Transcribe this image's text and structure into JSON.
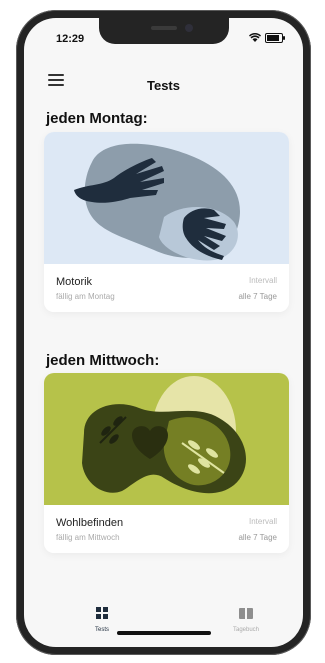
{
  "status_bar": {
    "time": "12:29"
  },
  "header": {
    "title": "Tests"
  },
  "sections": [
    {
      "title": "jeden Montag:",
      "card": {
        "name": "Motorik",
        "due": "fällig am Montag",
        "interval_label": "Intervall",
        "interval_value": "alle 7 Tage"
      }
    },
    {
      "title": "jeden Mittwoch:",
      "card": {
        "name": "Wohlbefinden",
        "due": "fällig am Mittwoch",
        "interval_label": "Intervall",
        "interval_value": "alle 7 Tage"
      }
    }
  ],
  "tabs": [
    {
      "label": "Tests",
      "icon": "grid-icon",
      "active": true
    },
    {
      "label": "Tagebuch",
      "icon": "book-icon",
      "active": false
    }
  ],
  "colors": {
    "accent": "#1f2d3d",
    "motorik_bg": "#dde8f5",
    "wohlbefinden_bg": "#b6c24a"
  }
}
